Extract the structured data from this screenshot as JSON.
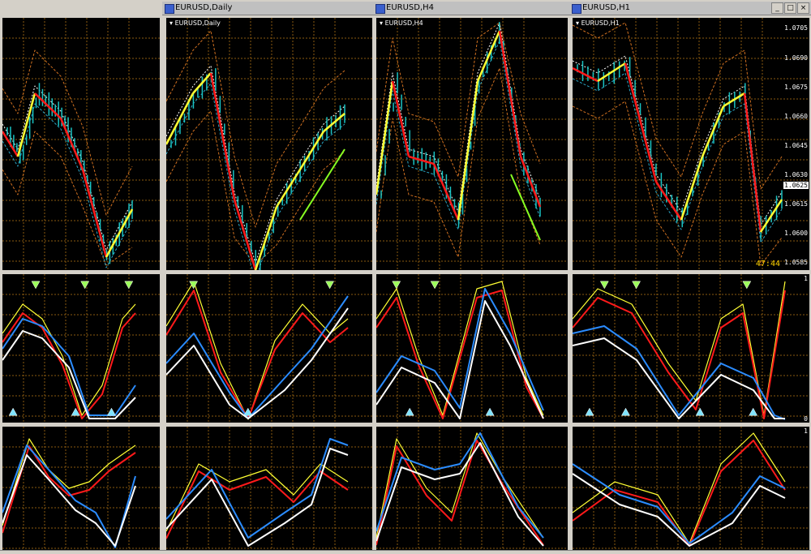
{
  "windows": [
    {
      "id": "w1",
      "title": "",
      "show_titlebar": false
    },
    {
      "id": "w2",
      "title": "EURUSD,Daily",
      "symbol_label": "EURUSD,Daily",
      "show_titlebar": true
    },
    {
      "id": "w3",
      "title": "EURUSD,H4",
      "symbol_label": "EURUSD,H4",
      "show_titlebar": true
    },
    {
      "id": "w4",
      "title": "EURUSD,H1",
      "symbol_label": "EURUSD,H1",
      "show_titlebar": true
    }
  ],
  "h1_price_axis": {
    "ticks": [
      "1.0705",
      "1.0690",
      "1.0675",
      "1.0660",
      "1.0645",
      "1.0630",
      "1.0615",
      "1.0600",
      "1.0585"
    ],
    "current_price": "1.0625",
    "bar_timer": "47:44"
  },
  "oscillator_axis": {
    "top": "1",
    "bottom": "0"
  },
  "second_oscillator_axis": {
    "top": "1"
  },
  "colors": {
    "background": "#000000",
    "grid": "#8a5a10",
    "candles": "#19c2c2",
    "up_line": "#ffff33",
    "down_line": "#ff1a1a",
    "signal_white": "#ffffff",
    "signal_blue": "#2b8cff",
    "trend_green": "#88ff22",
    "band_orange": "#d07020",
    "ma_cyan": "#2aa5c5"
  },
  "icons": [
    "arrow-down-icon",
    "arrow-up-icon",
    "cross-icon",
    "minimize-icon",
    "maximize-icon",
    "close-icon",
    "chart-window-icon",
    "dropdown-triangle-icon"
  ]
}
